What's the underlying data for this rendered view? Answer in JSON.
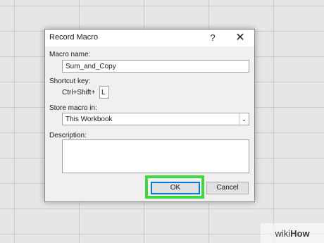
{
  "dialog": {
    "title": "Record Macro",
    "help_glyph": "?",
    "close_glyph": "✕",
    "macro_name_label": "Macro name:",
    "macro_name_value": "Sum_and_Copy",
    "shortcut_label": "Shortcut key:",
    "shortcut_prefix": "Ctrl+Shift+",
    "shortcut_value": "L",
    "store_label": "Store macro in:",
    "store_value": "This Workbook",
    "description_label": "Description:",
    "description_value": "",
    "ok_label": "OK",
    "cancel_label": "Cancel"
  },
  "highlight_color": "#3fd63f",
  "watermark": {
    "prefix": "wiki",
    "suffix": "How"
  }
}
